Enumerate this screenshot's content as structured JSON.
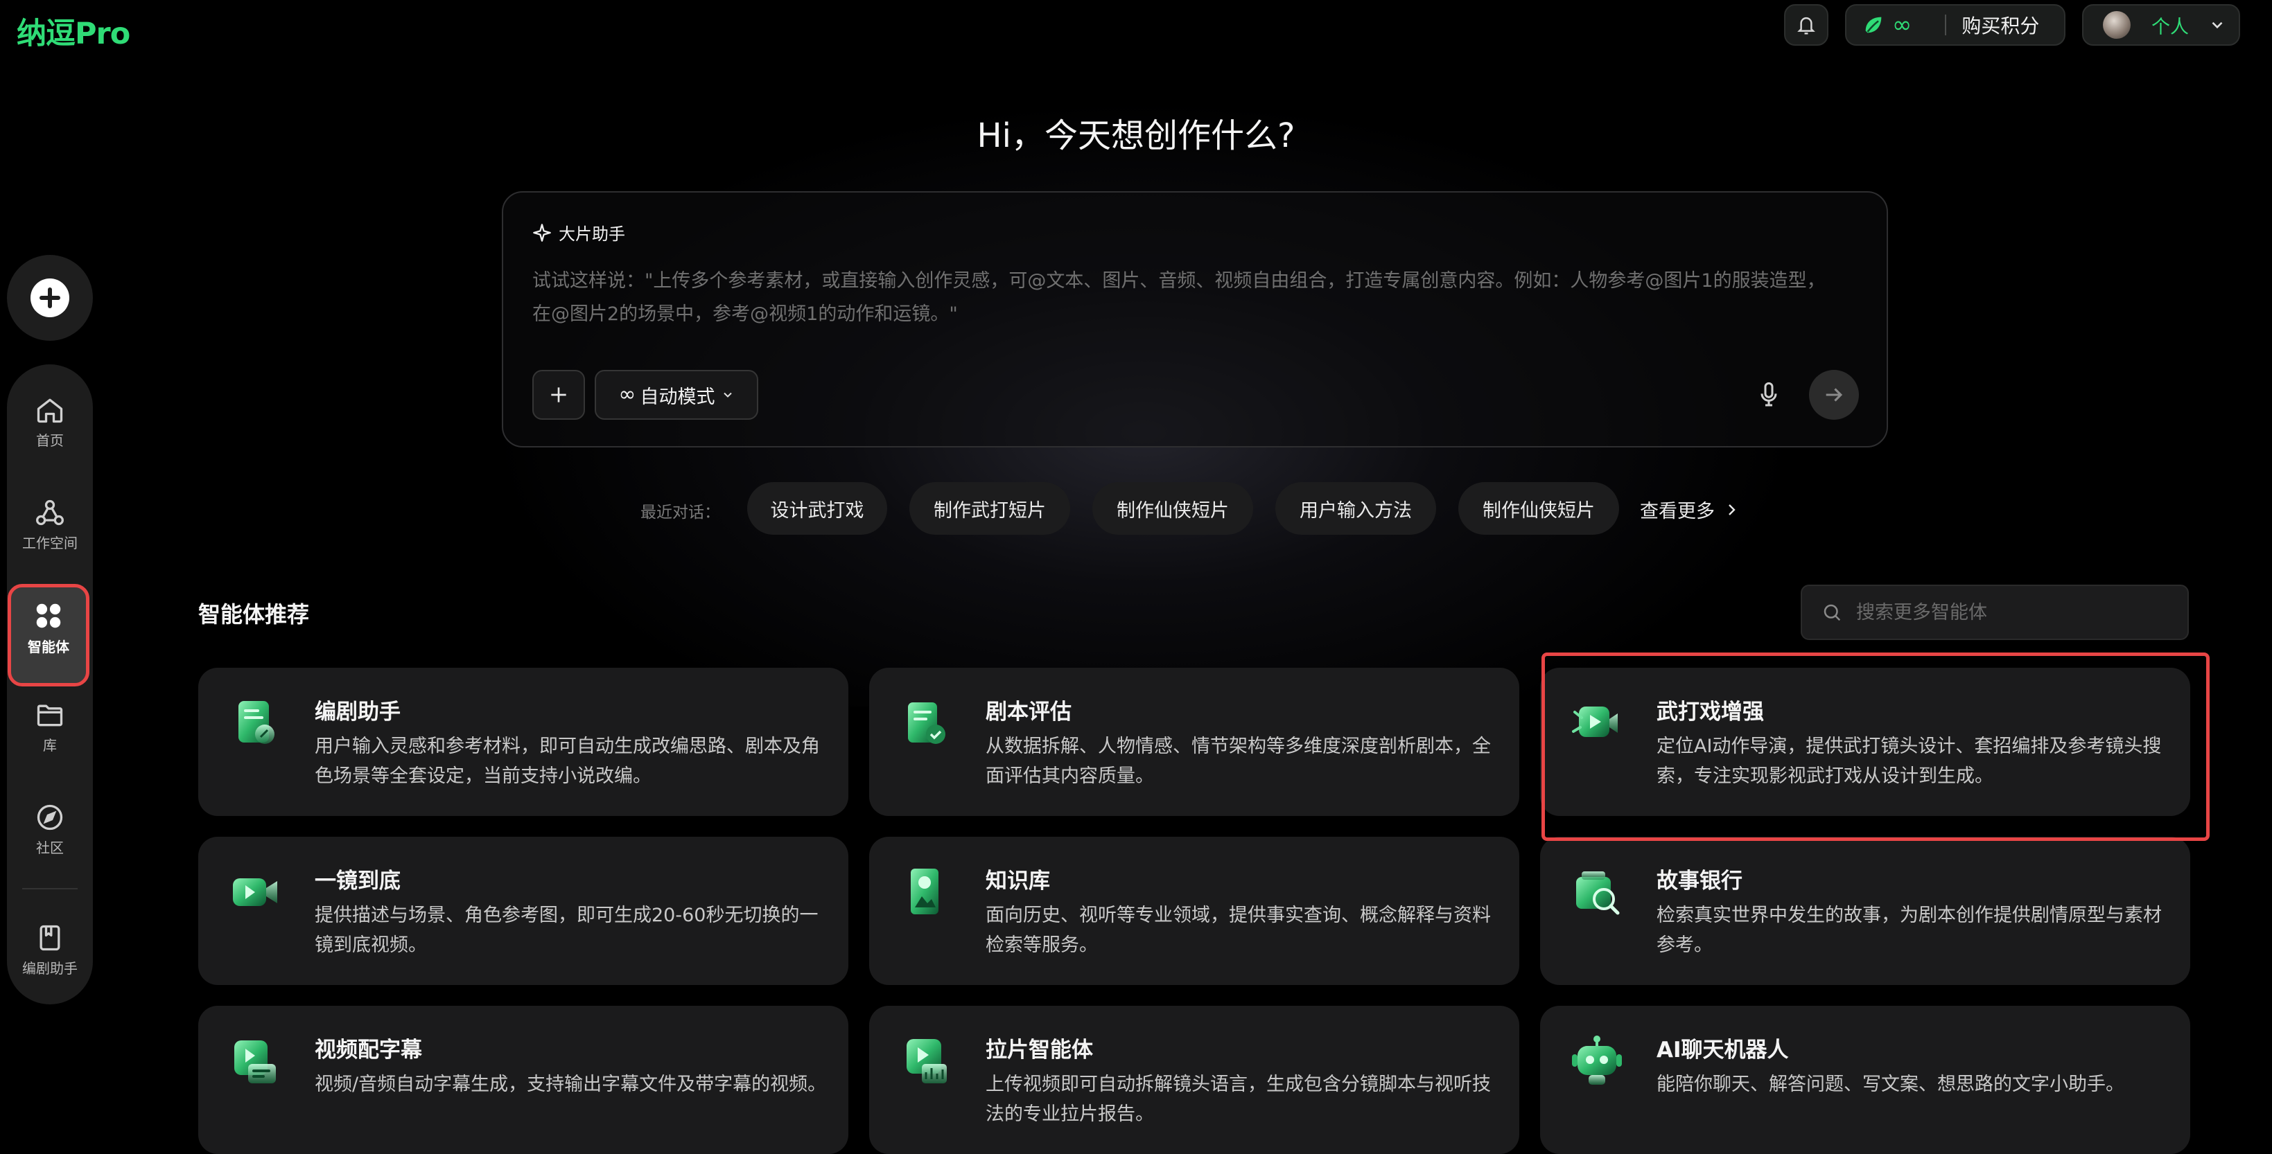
{
  "app": {
    "logo": "纳逗Pro"
  },
  "header": {
    "points_value": "∞",
    "buy_points": "购买积分",
    "profile_label": "个人"
  },
  "sidebar": {
    "items": [
      {
        "label": "首页",
        "icon": "home-icon"
      },
      {
        "label": "工作空间",
        "icon": "workspace-icon"
      },
      {
        "label": "智能体",
        "icon": "agents-grid-icon",
        "active": true
      },
      {
        "label": "库",
        "icon": "folder-icon"
      },
      {
        "label": "社区",
        "icon": "compass-icon"
      },
      {
        "label": "编剧助手",
        "icon": "script-book-icon"
      }
    ]
  },
  "hero": {
    "title": "Hi，今天想创作什么?"
  },
  "prompt": {
    "assistant_label": "大片助手",
    "placeholder": "试试这样说：\"上传多个参考素材，或直接输入创作灵感，可@文本、图片、音频、视频自由组合，打造专属创意内容。例如：人物参考@图片1的服装造型，在@图片2的场景中，参考@视频1的动作和运镜。\"",
    "mode_label": "自动模式"
  },
  "recent": {
    "label": "最近对话：",
    "items": [
      "设计武打戏",
      "制作武打短片",
      "制作仙侠短片",
      "用户输入方法",
      "制作仙侠短片"
    ],
    "more": "查看更多"
  },
  "agents": {
    "title": "智能体推荐",
    "search_placeholder": "搜索更多智能体",
    "cards": [
      {
        "title": "编剧助手",
        "desc": "用户输入灵感和参考材料，即可自动生成改编思路、剧本及角色场景等全套设定，当前支持小说改编。",
        "icon": "script-writer-icon"
      },
      {
        "title": "剧本评估",
        "desc": "从数据拆解、人物情感、情节架构等多维度深度剖析剧本，全面评估其内容质量。",
        "icon": "script-evaluation-icon"
      },
      {
        "title": "武打戏增强",
        "desc": "定位AI动作导演，提供武打镜头设计、套招编排及参考镜头搜索，专注实现影视武打戏从设计到生成。",
        "icon": "action-scene-icon"
      },
      {
        "title": "一镜到底",
        "desc": "提供描述与场景、角色参考图，即可生成20-60秒无切换的一镜到底视频。",
        "icon": "video-camera-icon"
      },
      {
        "title": "知识库",
        "desc": "面向历史、视听等专业领域，提供事实查询、概念解释与资料检索等服务。",
        "icon": "knowledge-base-icon"
      },
      {
        "title": "故事银行",
        "desc": "检索真实世界中发生的故事，为剧本创作提供剧情原型与素材参考。",
        "icon": "story-bank-icon"
      },
      {
        "title": "视频配字幕",
        "desc": "视频/音频自动字幕生成，支持输出字幕文件及带字幕的视频。",
        "icon": "video-subtitle-icon"
      },
      {
        "title": "拉片智能体",
        "desc": "上传视频即可自动拆解镜头语言，生成包含分镜脚本与视听技法的专业拉片报告。",
        "icon": "film-analysis-icon"
      },
      {
        "title": "AI聊天机器人",
        "desc": "能陪你聊天、解答问题、写文案、想思路的文字小助手。",
        "icon": "chat-robot-icon"
      }
    ]
  },
  "colors": {
    "accent": "#2fdc76",
    "highlight": "#e84545",
    "card_bg": "#1b1b1c"
  }
}
